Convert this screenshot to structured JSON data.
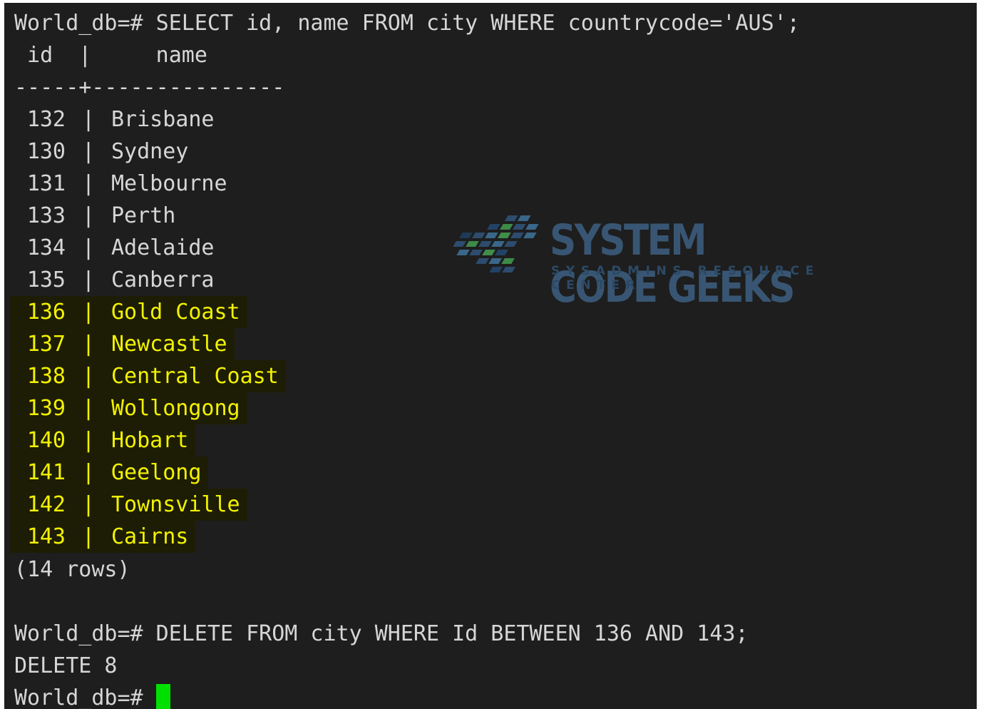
{
  "terminal": {
    "query_prompt": "World_db=# SELECT id, name FROM city WHERE countrycode='AUS';",
    "header_line": " id  |     name",
    "divider_line": "-----+---------------",
    "rows": [
      {
        "id": "132",
        "name": "Brisbane"
      },
      {
        "id": "130",
        "name": "Sydney"
      },
      {
        "id": "131",
        "name": "Melbourne"
      },
      {
        "id": "133",
        "name": "Perth"
      },
      {
        "id": "134",
        "name": "Adelaide"
      },
      {
        "id": "135",
        "name": "Canberra"
      },
      {
        "id": "136",
        "name": "Gold Coast"
      },
      {
        "id": "137",
        "name": "Newcastle"
      },
      {
        "id": "138",
        "name": "Central Coast"
      },
      {
        "id": "139",
        "name": "Wollongong"
      },
      {
        "id": "140",
        "name": "Hobart"
      },
      {
        "id": "141",
        "name": "Geelong"
      },
      {
        "id": "142",
        "name": "Townsville"
      },
      {
        "id": "143",
        "name": "Cairns"
      }
    ],
    "row_separator": "|",
    "row_count": "(14 rows)",
    "delete_prompt": "World_db=# DELETE FROM city WHERE Id BETWEEN 136 AND 143;",
    "delete_result": "DELETE 8",
    "final_prompt": "World_db=# ",
    "highlight_color": "#f2f200",
    "cursor_color": "#00e000",
    "background_color": "#1e1e1e"
  },
  "watermark": {
    "title": "SYSTEM CODE GEEKS",
    "subtitle": "SYSADMINS RESOURCE CENTER",
    "logo_icon": "pixel-arrow-logo-icon"
  }
}
